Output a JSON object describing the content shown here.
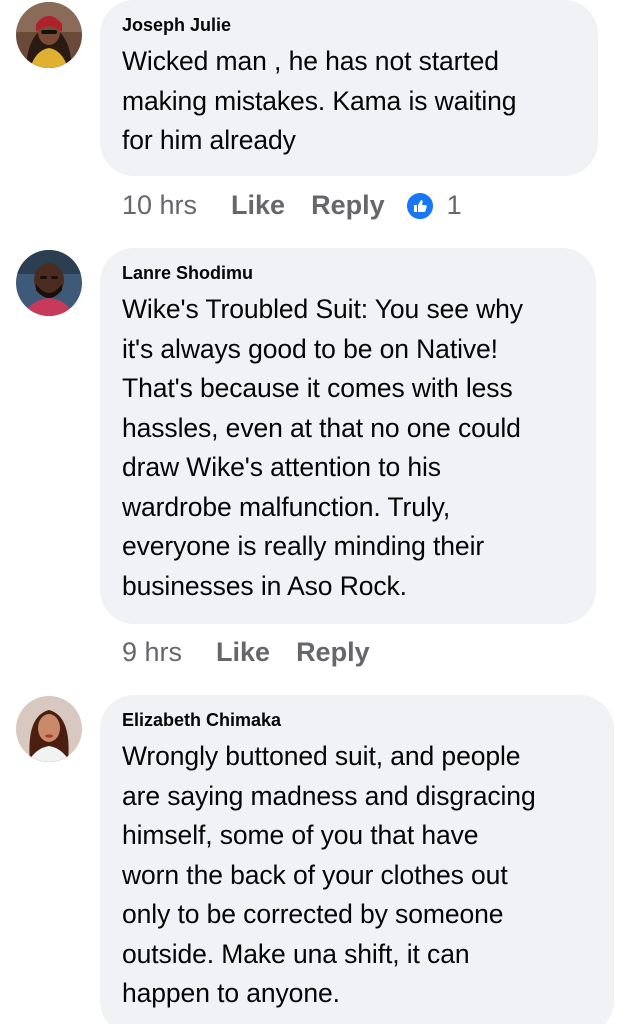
{
  "comments": [
    {
      "author": "Joseph Julie",
      "text": "Wicked man , he has not started\nmaking mistakes. Kama is waiting\nfor him already",
      "time": "10 hrs",
      "like_label": "Like",
      "reply_label": "Reply",
      "reaction_count": "1",
      "avatar_icon": "avatar-joseph-julie"
    },
    {
      "author": "Lanre Shodimu",
      "text": "Wike's Troubled Suit: You see why\nit's always good to be on Native!\nThat's because it comes with less\nhassles, even at that no one could\ndraw Wike's attention to his\nwardrobe malfunction. Truly,\neveryone is really minding their\nbusinesses  in Aso Rock.",
      "time": "9 hrs",
      "like_label": "Like",
      "reply_label": "Reply",
      "avatar_icon": "avatar-lanre-shodimu"
    },
    {
      "author": "Elizabeth Chimaka",
      "text": "Wrongly buttoned suit, and people\nare saying madness and disgracing\nhimself,  some of you that have\nworn the back of your clothes out\nonly to be corrected by someone\noutside.  Make una shift, it can\nhappen to anyone.",
      "avatar_icon": "avatar-elizabeth-chimaka"
    }
  ],
  "colors": {
    "bubble": "#f0f2f5",
    "meta_text": "#65676b",
    "like_blue": "#1877f2"
  }
}
